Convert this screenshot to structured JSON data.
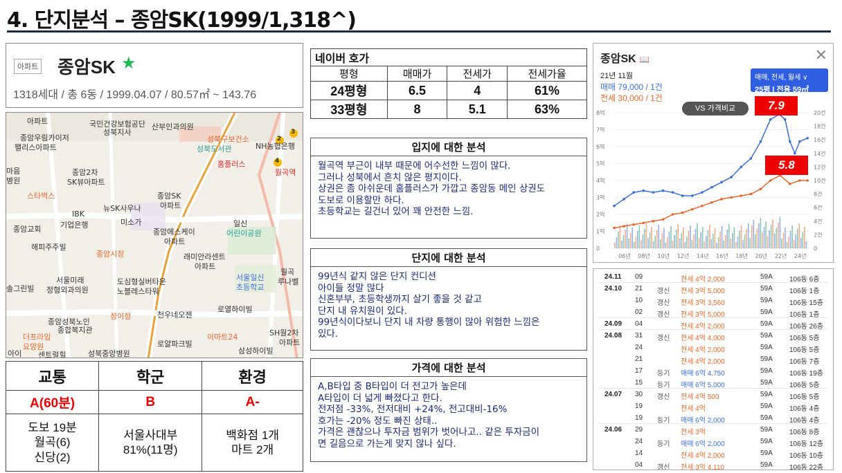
{
  "page": {
    "title": "4. 단지분석 – 종암SK(1999/1,318^)"
  },
  "apt": {
    "badge": "아파트",
    "name": "종암SK",
    "star": "★",
    "meta": "1318세대 / 총 6동 / 1999.04.07 / 80.57㎡ ~ 143.76"
  },
  "map": {
    "labels": [
      "아파트",
      "국민건강보험공단",
      "성북지사",
      "산부인과의원",
      "종암우림카이저",
      "팰리스아파트",
      "성북도서관",
      "성북구보건소",
      "NH농협은행",
      "마음",
      "병원",
      "종암2차",
      "SK뷰아파트",
      "홈플러스",
      "월곡역",
      "스타벅스",
      "종암SK",
      "아파트",
      "뉴SK사우나",
      "IBK",
      "기업은행",
      "종암교회",
      "미소가",
      "종암에스케이",
      "아파트",
      "일신",
      "어린이공원",
      "해피주주빌",
      "종암시장",
      "래미안라센트",
      "아파트",
      "서울미래",
      "정형외과의원",
      "도심형실버타운",
      "노블레스타워",
      "서울일신",
      "초등학교",
      "월곡",
      "루나벨",
      "솔그린빌",
      "정이정",
      "로열하이빌",
      "천우네오젠",
      "종암성북노인",
      "종합복지관",
      "더프라임",
      "요양원",
      "로얄파크빌",
      "이마트24",
      "SH월2차",
      "아파트",
      "삼성하이빌",
      "센트럴힐",
      "성북중앙병원",
      "아이"
    ],
    "markers": [
      "2",
      "3",
      "4"
    ]
  },
  "grades": {
    "headers": [
      "교통",
      "학군",
      "환경"
    ],
    "grades": [
      "A(60분)",
      "B",
      "A-"
    ],
    "details": [
      [
        "도보 19분",
        "월곡(6)",
        "신당(2)"
      ],
      [
        "서울사대부",
        "81%(11명)"
      ],
      [
        "백화점 1개",
        "마트 2개"
      ]
    ]
  },
  "price_table": {
    "title": "네이버 호가",
    "headers": [
      "평형",
      "매매가",
      "전세가",
      "전세가율"
    ],
    "rows": [
      [
        "24평형",
        "6.5",
        "4",
        "61%"
      ],
      [
        "33평형",
        "8",
        "5.1",
        "63%"
      ]
    ]
  },
  "analysis": [
    {
      "title": "입지에 대한 분석",
      "lines": [
        "월곡역 부근이 내부 때문에 어수선한 느낌이 많다.",
        "그러나 성북에서 흔치 않은 평지이다.",
        "상권은 좀 아쉬운데 홈플러스가 가깝고 종암동 메인 상권도",
        "도보로 이용할만 하다.",
        "초등학교는 길건너 있어 꽤 안전한 느낌."
      ]
    },
    {
      "title": "단지에 대한 분석",
      "lines": [
        "99년식 같지 않은 단지 컨디션",
        "아이들 정말 많다",
        "신혼부부, 초등학생까지 살기 좋을 것 같고",
        "단지 내 유치원이 있다.",
        "99년식이다보니 단지 내 차량 통행이 많아 위험한 느낌은",
        "있다."
      ]
    },
    {
      "title": "가격에 대한 분석",
      "lines": [
        "A,B타입 중 B타입이 더 전고가 높은데",
        "A타입이 더 넓게 빠졌다고 한다.",
        "전저점 -33%, 전저대비 +24%, 전고대비-16%",
        "호가는 -20% 정도 빠진 상태..",
        "가격은 괜찮으나 투자금 범위가 벗어나고.. 같은 투자금이",
        "면 길음으로 가는게 맞지 않나 싶다."
      ]
    }
  ],
  "chart_panel": {
    "title": "종암SK",
    "title_icon": "book-icon",
    "close": "✕",
    "month": "21년 11월",
    "trade": "매매 79,000 / 1건",
    "jeonse": "전세 30,000 / 1건",
    "filter_line1": "매매, 전세, 월세 ∨",
    "filter_line2": "25평 | 전용 59㎡",
    "vs_button": "VS 가격비교",
    "badge_trade": "7.9",
    "badge_jeonse": "5.8",
    "colors": {
      "trade": "#3b6fd8",
      "jeonse": "#e8672a",
      "volume_trade": "#3b6fd8",
      "volume_jeonse": "#e8672a",
      "volume_other": "#2a9d6a"
    }
  },
  "chart_data": {
    "type": "line",
    "x_ticks": [
      "06년",
      "08년",
      "10년",
      "12년",
      "14년",
      "16년",
      "18년",
      "20년",
      "22년",
      "24년"
    ],
    "y_left_ticks": [
      "0",
      "1억",
      "2억",
      "3억",
      "4억",
      "5억",
      "6억",
      "7억",
      "8억"
    ],
    "y_right_ticks": [
      "0",
      "2건",
      "4건",
      "6건",
      "8건",
      "10건",
      "12건",
      "14건",
      "16건",
      "18건",
      "20건"
    ],
    "ylim": [
      0,
      8
    ],
    "series": [
      {
        "name": "매매",
        "x": [
          2005,
          2006,
          2007,
          2008,
          2009,
          2010,
          2011,
          2012,
          2013,
          2014,
          2015,
          2016,
          2017,
          2018,
          2019,
          2020,
          2021,
          2021.9,
          2022.5,
          2023,
          2023.5,
          2024,
          2024.8
        ],
        "values": [
          2.5,
          2.9,
          3.3,
          3.4,
          3.3,
          3.4,
          3.3,
          3.1,
          3.1,
          3.3,
          3.6,
          3.9,
          4.2,
          4.8,
          5.3,
          6.3,
          7.6,
          7.9,
          7.6,
          6.3,
          5.6,
          6.3,
          6.5
        ]
      },
      {
        "name": "전세",
        "x": [
          2005,
          2006,
          2007,
          2008,
          2009,
          2010,
          2011,
          2012,
          2013,
          2014,
          2015,
          2016,
          2017,
          2018,
          2019,
          2020,
          2021,
          2022,
          2023,
          2024,
          2024.8
        ],
        "values": [
          1.2,
          1.3,
          1.4,
          1.5,
          1.6,
          1.7,
          2.0,
          2.1,
          2.3,
          2.5,
          2.7,
          2.9,
          3.0,
          3.1,
          3.2,
          3.5,
          4.0,
          4.3,
          3.8,
          4.0,
          4.0
        ]
      }
    ]
  },
  "transactions": [
    {
      "ym": "24.11",
      "day": "09",
      "type": "",
      "price": "전세 4억 2,000",
      "kind": "jeonse",
      "area": "59A",
      "floor": "106동 6층"
    },
    {
      "ym": "24.10",
      "day": "21",
      "type": "갱신",
      "price": "전세 3억 5,000",
      "kind": "jeonse",
      "area": "59A",
      "floor": "106동 1층"
    },
    {
      "ym": "",
      "day": "10",
      "type": "갱신",
      "price": "전세 3억 3,560",
      "kind": "jeonse",
      "area": "59A",
      "floor": "106동 15층"
    },
    {
      "ym": "",
      "day": "02",
      "type": "갱신",
      "price": "전세 3억 5,000",
      "kind": "jeonse",
      "area": "59A",
      "floor": "106동 1층"
    },
    {
      "ym": "24.09",
      "day": "04",
      "type": "",
      "price": "전세 4억 2,000",
      "kind": "jeonse",
      "area": "59A",
      "floor": "106동 26층"
    },
    {
      "ym": "24.08",
      "day": "31",
      "type": "갱신",
      "price": "전세 4억 4,000",
      "kind": "jeonse",
      "area": "59A",
      "floor": "106동 5층"
    },
    {
      "ym": "",
      "day": "24",
      "type": "",
      "price": "전세 4억 2,000",
      "kind": "jeonse",
      "area": "59A",
      "floor": "106동 5층"
    },
    {
      "ym": "",
      "day": "21",
      "type": "",
      "price": "전세 4억 2,000",
      "kind": "jeonse",
      "area": "59A",
      "floor": "106동 7층"
    },
    {
      "ym": "",
      "day": "17",
      "type": "등기",
      "price": "매매 6억 4,750",
      "kind": "trade",
      "area": "59A",
      "floor": "106동 19층"
    },
    {
      "ym": "",
      "day": "15",
      "type": "등기",
      "price": "매매 6억 5,000",
      "kind": "trade",
      "area": "59A",
      "floor": "106동 5층"
    },
    {
      "ym": "24.07",
      "day": "30",
      "type": "갱신",
      "price": "전세 4억 500",
      "kind": "jeonse",
      "area": "59A",
      "floor": "106동 5층"
    },
    {
      "ym": "",
      "day": "19",
      "type": "",
      "price": "전세 4억",
      "kind": "jeonse",
      "area": "59A",
      "floor": "106동 4층"
    },
    {
      "ym": "",
      "day": "19",
      "type": "등기",
      "price": "매매 6억 2,000",
      "kind": "trade",
      "area": "59A",
      "floor": "106동 4층"
    },
    {
      "ym": "24.06",
      "day": "29",
      "type": "",
      "price": "전세 3억",
      "kind": "jeonse",
      "area": "59A",
      "floor": "106동 8층"
    },
    {
      "ym": "",
      "day": "24",
      "type": "등기",
      "price": "매매 6억 2,000",
      "kind": "trade",
      "area": "59A",
      "floor": "106동 12층"
    },
    {
      "ym": "",
      "day": "14",
      "type": "",
      "price": "전세 4억 2,000",
      "kind": "jeonse",
      "area": "59A",
      "floor": "106동 10층"
    },
    {
      "ym": "",
      "day": "04",
      "type": "갱신",
      "price": "전세 3억 4,110",
      "kind": "jeonse",
      "area": "59A",
      "floor": "106동 22층"
    }
  ]
}
